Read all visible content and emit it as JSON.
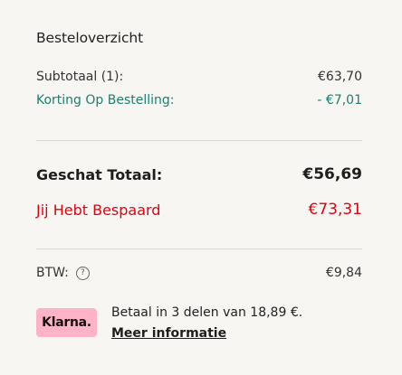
{
  "summary": {
    "title": "Besteloverzicht",
    "subtotal_label": "Subtotaal (1):",
    "subtotal_value": "€63,70",
    "discount_label": "Korting Op Bestelling:",
    "discount_value": "- €7,01",
    "total_label": "Geschat Totaal:",
    "total_value": "€56,69",
    "saved_label": "Jij Hebt Bespaard",
    "saved_value": "€73,31",
    "vat_label": "BTW:",
    "vat_info_icon": "?",
    "vat_value": "€9,84"
  },
  "klarna": {
    "logo": "Klarna.",
    "installments_text": "Betaal in 3 delen van 18,89 €.",
    "more_info_link": "Meer informatie"
  },
  "colors": {
    "background": "#f7f6f2",
    "discount": "#1d7f6e",
    "savings": "#e3000f",
    "klarna_pink": "#ffb3c7"
  }
}
